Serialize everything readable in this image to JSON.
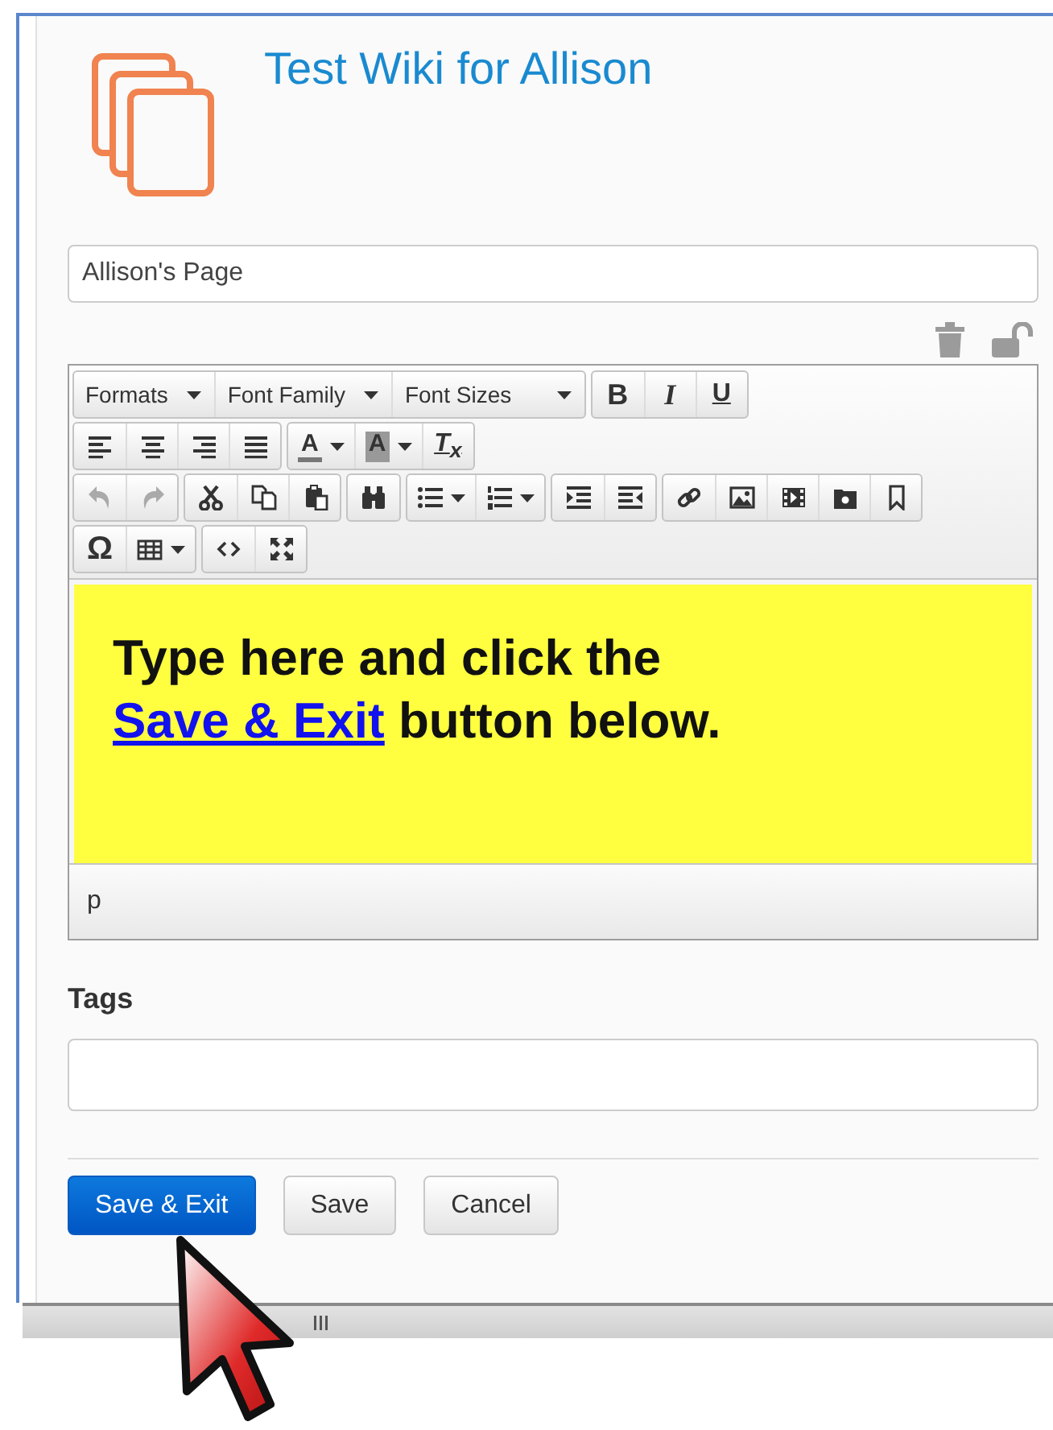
{
  "header": {
    "title": "Test Wiki for Allison"
  },
  "page_title": {
    "value": "Allison's Page"
  },
  "toolbar": [
    [
      [
        {
          "kind": "dropdown",
          "text": "Formats",
          "disabled": false
        },
        {
          "kind": "dropdown",
          "text": "Font Family",
          "disabled": false
        },
        {
          "kind": "dropdown",
          "text": "Font Sizes",
          "disabled": false
        }
      ],
      [
        {
          "kind": "bold",
          "text": "B",
          "disabled": false
        },
        {
          "kind": "italic",
          "text": "I",
          "disabled": false
        },
        {
          "kind": "underline",
          "text": "U",
          "disabled": false
        }
      ]
    ],
    [
      [
        {
          "kind": "align-left",
          "disabled": false
        },
        {
          "kind": "align-center",
          "disabled": false
        },
        {
          "kind": "align-right",
          "disabled": false
        },
        {
          "kind": "justify",
          "disabled": false
        }
      ],
      [
        {
          "kind": "text-color",
          "text": "A",
          "disabled": false
        },
        {
          "kind": "bg-color",
          "text": "A",
          "disabled": false
        },
        {
          "kind": "clear-format",
          "text": "T$_{x}$",
          "disabled": false
        }
      ]
    ],
    [
      [
        {
          "kind": "undo",
          "disabled": true
        },
        {
          "kind": "redo",
          "disabled": true
        }
      ],
      [
        {
          "kind": "cut",
          "disabled": false
        },
        {
          "kind": "copy",
          "disabled": false
        },
        {
          "kind": "paste",
          "disabled": false
        }
      ],
      [
        {
          "kind": "find",
          "disabled": false
        }
      ],
      [
        {
          "kind": "bullet-list",
          "disabled": false
        },
        {
          "kind": "numbered-list",
          "disabled": false
        }
      ],
      [
        {
          "kind": "indent",
          "disabled": false
        },
        {
          "kind": "outdent",
          "disabled": false
        }
      ],
      [
        {
          "kind": "link",
          "disabled": false
        },
        {
          "kind": "image",
          "disabled": false
        },
        {
          "kind": "media",
          "disabled": false
        },
        {
          "kind": "preview",
          "disabled": false
        },
        {
          "kind": "bookmark",
          "disabled": false
        }
      ]
    ],
    [
      [
        {
          "kind": "symbol",
          "text": "Ω",
          "disabled": false
        },
        {
          "kind": "table",
          "disabled": false
        }
      ],
      [
        {
          "kind": "code",
          "disabled": false
        },
        {
          "kind": "fullscreen",
          "disabled": false
        }
      ]
    ]
  ],
  "editor": {
    "before": "Type here and click the",
    "link": "Save & Exit",
    "after": "button below.",
    "status_path": "p"
  },
  "tags": {
    "label": "Tags"
  },
  "buttons": [
    {
      "label": "Save & Exit",
      "kind": "primary"
    },
    {
      "label": "Save",
      "kind": "default"
    },
    {
      "label": "Cancel",
      "kind": "default"
    }
  ]
}
